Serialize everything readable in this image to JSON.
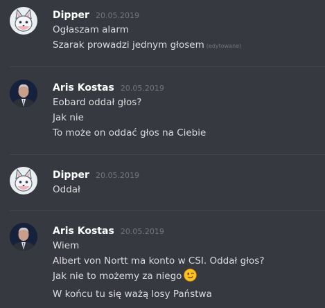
{
  "colors": {
    "background": "#36393f",
    "username": "#ffffff",
    "text": "#dcddde",
    "muted": "#72767d",
    "divider": "#42454a"
  },
  "messages": [
    {
      "username": "Dipper",
      "timestamp": "20.05.2019",
      "avatar": "fox-avatar-icon",
      "lines": [
        {
          "text": "Ogłaszam alarm"
        },
        {
          "text": "Szarak prowadzi jednym głosem",
          "edited": "(edytowane)"
        }
      ]
    },
    {
      "username": "Aris Kostas",
      "timestamp": "20.05.2019",
      "avatar": "man-in-suit-avatar-icon",
      "lines": [
        {
          "text": "Eobard oddał głos?"
        },
        {
          "text": "Jak nie"
        },
        {
          "text": "To może on oddać głos na Ciebie"
        }
      ]
    },
    {
      "username": "Dipper",
      "timestamp": "20.05.2019",
      "avatar": "fox-avatar-icon",
      "lines": [
        {
          "text": "Oddał"
        }
      ]
    },
    {
      "username": "Aris Kostas",
      "timestamp": "20.05.2019",
      "avatar": "man-in-suit-avatar-icon",
      "lines": [
        {
          "text": "Wiem"
        },
        {
          "text": "Albert von Nortt ma konto w CSI. Oddał głos?"
        },
        {
          "text": "Jak nie to możemy za niego",
          "emoji": "winking-face-emoji"
        },
        {
          "text": "W końcu tu się ważą losy Państwa"
        }
      ]
    }
  ]
}
